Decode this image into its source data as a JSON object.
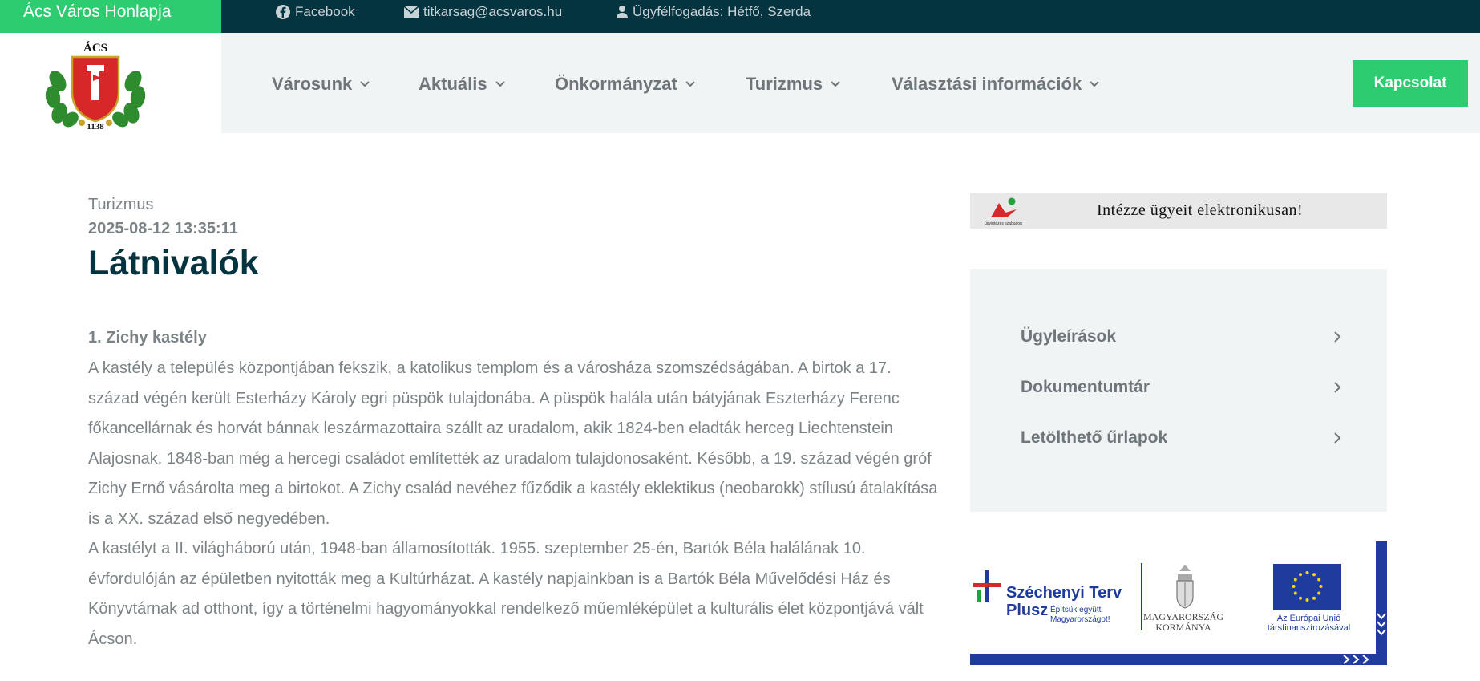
{
  "topbar": {
    "brand": "Ács Város Honlapja",
    "facebook": "Facebook",
    "email": "titkarsag@acsvaros.hu",
    "office_hours": "Ügyfélfogadás: Hétfő, Szerda"
  },
  "logo": {
    "top_text": "ÁCS",
    "bottom_text": "1138"
  },
  "nav": {
    "items": [
      "Városunk",
      "Aktuális",
      "Önkormányzat",
      "Turizmus",
      "Választási információk"
    ],
    "contact": "Kapcsolat"
  },
  "article": {
    "category": "Turizmus",
    "date": "2025-08-12 13:35:11",
    "title": "Látnivalók",
    "subheading": "1. Zichy kastély",
    "paragraph1": "A kastély a település központjában fekszik, a katolikus templom és a városháza szomszédságában. A birtok a 17. század végén került Esterházy Károly egri püspök tulajdonába. A püspök halála után bátyjának Eszterházy Ferenc főkancellárnak és horvát bánnak leszármazottaira szállt az uradalom, akik 1824-ben eladták herceg Liechtenstein Alajosnak. 1848-ban még a hercegi családot említették az uradalom tulajdonosaként. Később, a 19. század végén gróf Zichy Ernő vásárolta meg a birtokot. A Zichy család nevéhez fűződik a kastély eklektikus (neobarokk) stílusú átalakítása is a XX. század első negyedében.",
    "paragraph2": "A kastélyt a II. világháború után, 1948-ban államosították. 1955. szeptember 25-én, Bartók Béla halálának 10. évfordulóján az épületben nyitották meg a Kultúrházat. A kastély napjainkban is a Bartók Béla Művelődési Ház és Könyvtárnak ad otthont, így a történelmi hagyományokkal rendelkező műemléképület a kulturális élet központjává vált Ácson."
  },
  "sidebar": {
    "banner_text": "Intézze ügyeit elektronikusan!",
    "banner_small": "ügyintézés szabadon",
    "links": [
      "Ügyleírások",
      "Dokumentumtár",
      "Letölthető űrlapok"
    ]
  },
  "funding": {
    "szechenyi_line1": "Széchenyi Terv",
    "szechenyi_line2": "Plusz",
    "szechenyi_slogan": "Építsük együtt Magyarországot!",
    "kormany_line1": "MAGYARORSZÁG",
    "kormany_line2": "KORMÁNYA",
    "eu_line1": "Az Európai Unió",
    "eu_line2": "társfinanszírozásával"
  },
  "colors": {
    "dark_teal": "#04343f",
    "accent_green": "#2ecc71",
    "text_gray": "#7b8387",
    "eu_blue": "#1d3c9e"
  }
}
